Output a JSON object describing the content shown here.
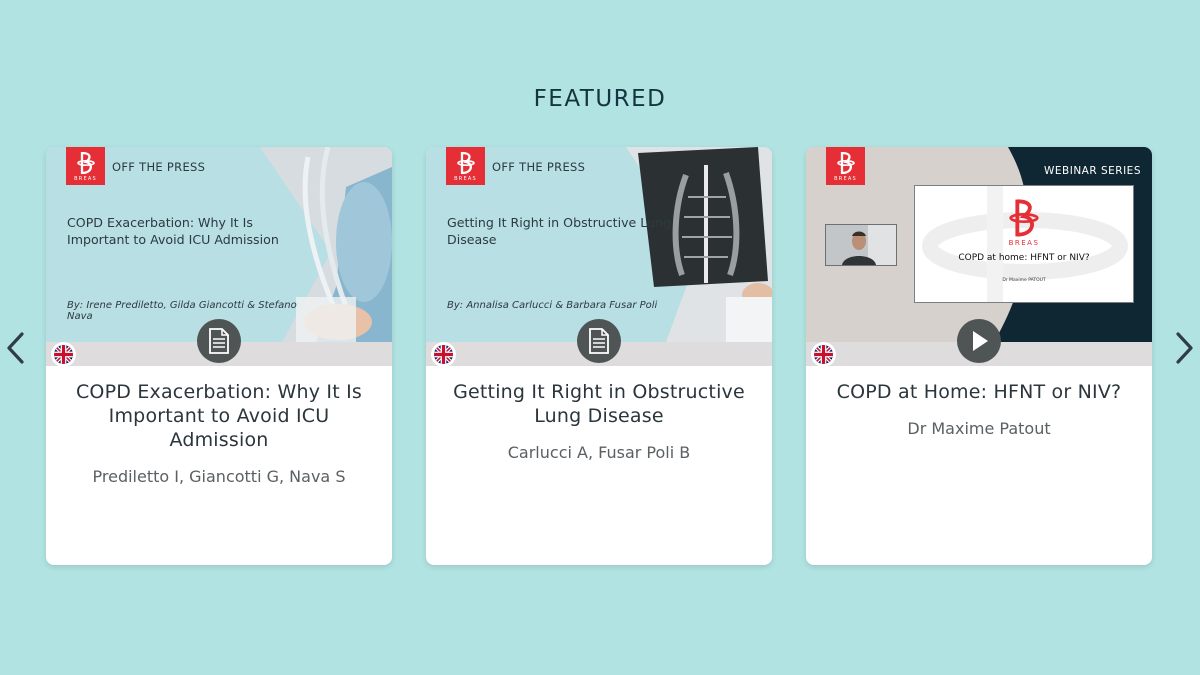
{
  "section": {
    "title": "FEATURED"
  },
  "nav": {
    "prev_icon": "chevron-left-icon",
    "next_icon": "chevron-right-icon"
  },
  "brand": {
    "word": "BREAS",
    "color": "#e52e35"
  },
  "cards": [
    {
      "kicker": "OFF THE PRESS",
      "thumb_title": "COPD Exacerbation: Why It Is Important to Avoid ICU Admission",
      "thumb_authors": "By: Irene Prediletto, Gilda Giancotti & Stefano Nava",
      "media_icon": "document-icon",
      "language": "uk-flag-icon",
      "title": "COPD Exacerbation: Why It Is Important to Avoid ICU Admission",
      "author": "Prediletto I, Giancotti G, Nava S"
    },
    {
      "kicker": "OFF THE PRESS",
      "thumb_title": "Getting It Right in Obstructive Lung Disease",
      "thumb_authors": "By: Annalisa Carlucci & Barbara Fusar Poli",
      "media_icon": "document-icon",
      "language": "uk-flag-icon",
      "title": "Getting It Right in Obstructive Lung Disease",
      "author": "Carlucci A, Fusar Poli B"
    },
    {
      "kicker": "WEBINAR SERIES",
      "slide_word": "BREAS",
      "slide_title": "COPD at home: HFNT or NIV?",
      "slide_presenter": "Dr Maxime PATOUT",
      "media_icon": "play-icon",
      "language": "uk-flag-icon",
      "title": "COPD at Home: HFNT or NIV?",
      "author": "Dr Maxime Patout"
    }
  ]
}
